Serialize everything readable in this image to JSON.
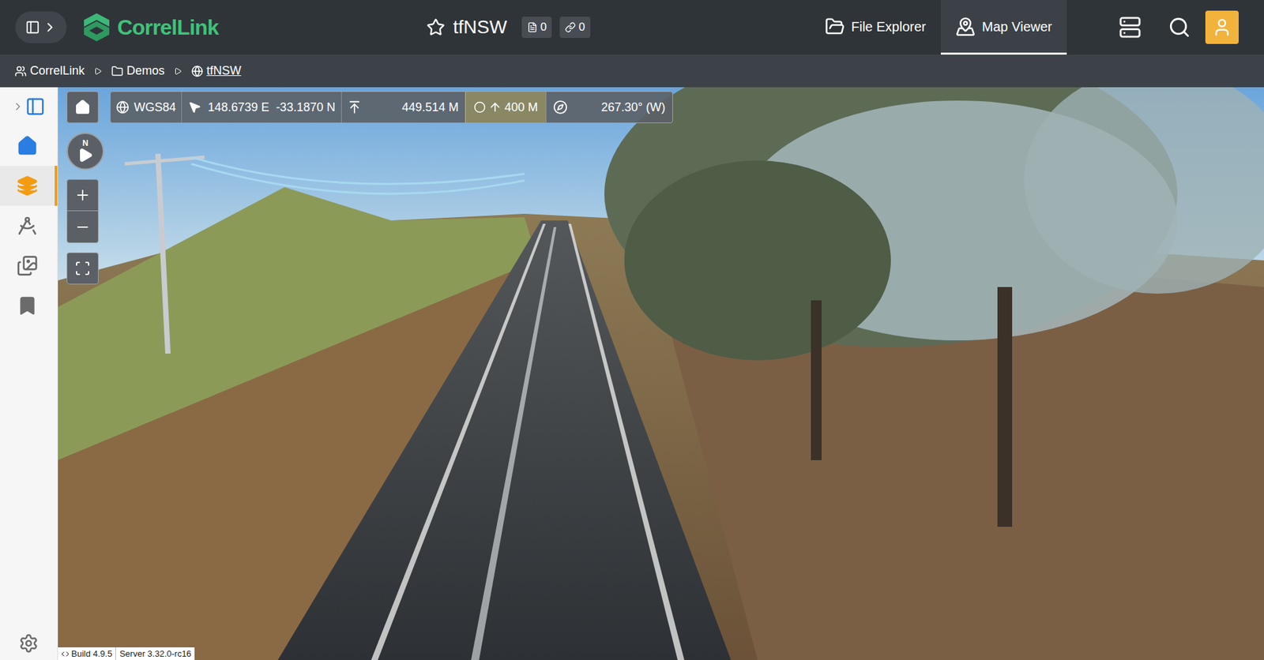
{
  "header": {
    "logo": "CorrelLink",
    "title": "tfNSW",
    "badges": [
      {
        "kind": "files",
        "count": "0"
      },
      {
        "kind": "links",
        "count": "0"
      }
    ],
    "nav": [
      {
        "kind": "files",
        "label": "File Explorer",
        "selected": false
      },
      {
        "kind": "map",
        "label": "Map Viewer",
        "selected": true
      }
    ]
  },
  "breadcrumbs": [
    {
      "kind": "group",
      "label": "CorrelLink",
      "current": false
    },
    {
      "kind": "folder",
      "label": "Demos",
      "current": false
    },
    {
      "kind": "globe",
      "label": "tfNSW",
      "current": true
    }
  ],
  "sidebar": {
    "items": [
      {
        "kind": "home",
        "selected": false
      },
      {
        "kind": "layers",
        "selected": true
      },
      {
        "kind": "measure",
        "selected": false
      },
      {
        "kind": "images",
        "selected": false
      },
      {
        "kind": "bookmark",
        "selected": false
      }
    ]
  },
  "toolbar": {
    "crs": "WGS84",
    "longitude": "148.6739 E",
    "latitude": "-33.1870 N",
    "elevation": "449.514 M",
    "height": "400 M",
    "height_active": true,
    "heading": "267.30° (W)"
  },
  "compass": {
    "label": "N"
  },
  "footer": {
    "build": "Build 4.9.5",
    "server": "Server 3.32.0-rc16"
  }
}
